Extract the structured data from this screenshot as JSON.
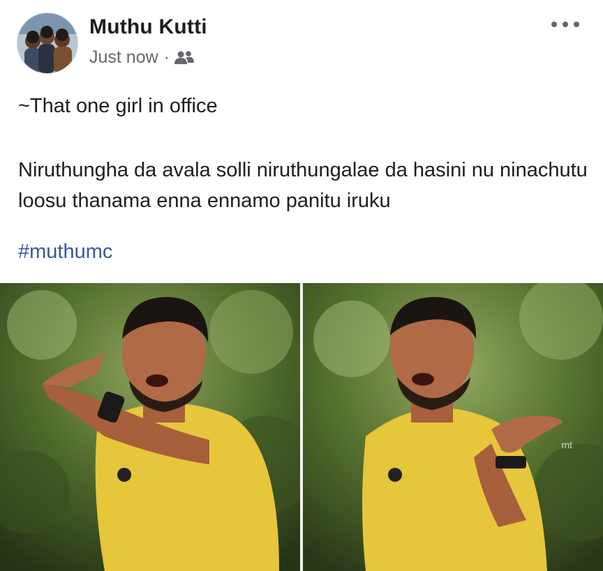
{
  "post": {
    "author": "Muthu Kutti",
    "timestamp": "Just now",
    "separator": "·",
    "audience_icon": "friends-icon",
    "more_icon": "more-options-icon",
    "text_line1": "~That one girl in office",
    "text_para2": "Niruthungha da avala solli niruthungalae da hasini nu ninachutu loosu thanama enna ennamo panitu iruku",
    "hashtag": "#muthumc"
  },
  "media": {
    "watermark": "mt",
    "colors": {
      "shirt": "#e6c63a",
      "foliage": "#5f7a33",
      "skin": "#b06a45"
    }
  }
}
